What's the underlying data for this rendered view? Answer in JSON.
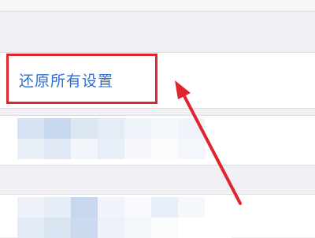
{
  "settings": {
    "reset_all_label": "还原所有设置"
  },
  "annotation": {
    "highlight_color": "#e0242b",
    "arrow_color": "#e0242b"
  },
  "mosaic": {
    "row1": [
      "#d7e3f2",
      "#c6d7ee",
      "#dde7f4",
      "#e4ecf6",
      "#eef3f9",
      "#f4f7fb",
      "#f0f4fa",
      "#ffffff",
      "#eaf0f8",
      "#dfe8f4",
      "#f2f6fb",
      "#e8eef7",
      "#f6f8fc",
      "#fbfcfe",
      "#f3f6fb",
      "#ffffff"
    ],
    "row2": [
      "#eef2f8",
      "#e6edf6",
      "#c7d8ee",
      "#f0f4fa",
      "#f7f9fc",
      "#e7eef7",
      "#f5f8fc",
      "#ffffff",
      "#e3ebf6",
      "#d9e4f2",
      "#cbdaef",
      "#edf2f9",
      "#f4f7fb",
      "#fafbfd",
      "#ffffff",
      "#ffffff"
    ]
  }
}
